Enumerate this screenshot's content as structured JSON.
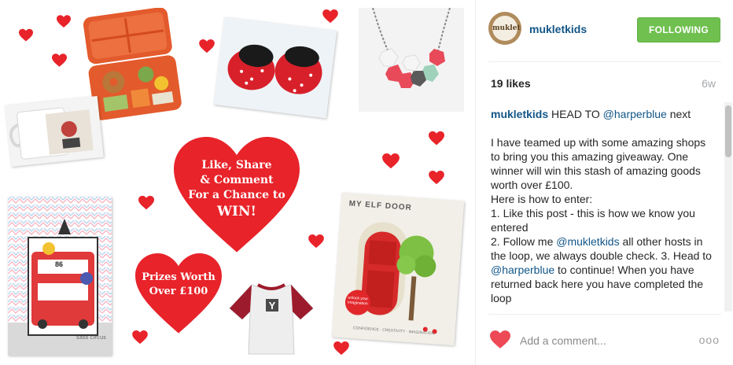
{
  "post": {
    "promo_main": [
      "Like, Share",
      "& Comment",
      "For a Chance to",
      "WIN!"
    ],
    "promo_prizes": [
      "Prizes Worth",
      "Over £100"
    ],
    "elf_door": {
      "title": "MY ELF DOOR",
      "badge": "unlock your imagination",
      "tagline": "CONFIDENCE · CREATIVITY · IMAGINATION"
    },
    "bus_sign": "86",
    "print_brand": "sass circus"
  },
  "profile": {
    "avatar_text": "muklet",
    "username": "mukletkids",
    "follow_label": "FOLLOWING"
  },
  "stats": {
    "likes": "19 likes",
    "age": "6w"
  },
  "caption": {
    "author": "mukletkids",
    "line1_pre": "HEAD TO ",
    "mention1": "@harperblue",
    "line1_post": " next",
    "para1": "I have teamed up with some amazing shops to bring you this amazing giveaway. One winner will win this stash of amazing goods worth over £100.",
    "para2": "Here is how to enter:",
    "para3": "1. Like this post - this is how we know you entered",
    "para4_pre": "2. Follow me ",
    "mention2": "@mukletkids",
    "para4_post": " all other hosts in the loop, we always double check. 3. Head to ",
    "mention3": "@harperblue",
    "para4_end": " to continue! When you have returned back here you have completed the loop"
  },
  "comment": {
    "placeholder": "Add a comment...",
    "more": "ooo"
  },
  "colors": {
    "heart_red": "#e8232a",
    "link_blue": "#125688",
    "follow_green": "#70c050"
  }
}
